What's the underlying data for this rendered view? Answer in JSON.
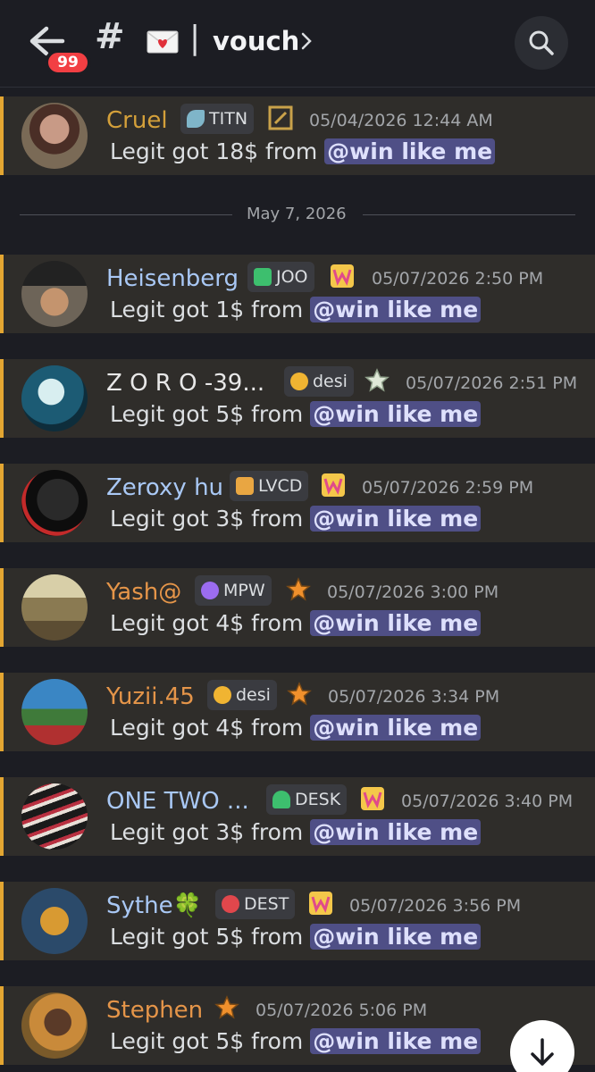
{
  "header": {
    "notification_count": "99",
    "hash": "#",
    "separator": "|",
    "channel_name": "vouch"
  },
  "date_divider": "May 7, 2026",
  "messages": [
    {
      "name": "Cruel",
      "name_color": "#d4a03a",
      "tag": "TITN",
      "tag_icon_color": "#7fb5c9",
      "timestamp": "05/04/2026 12:44 AM",
      "text": "Legit got 18$ from",
      "mention": "@win like me"
    },
    {
      "name": "Heisenberg",
      "name_color": "#a9c8f5",
      "tag": "JOO",
      "tag_icon_color": "#3dbf6e",
      "timestamp": "05/07/2026 2:50 PM",
      "text": "Legit got 1$ from",
      "mention": "@win like me"
    },
    {
      "name": "Z O R O -39...",
      "name_color": "#e8e8e8",
      "tag": "desi",
      "tag_icon_color": "#f0b432",
      "timestamp": "05/07/2026 2:51 PM",
      "text": "Legit got 5$ from",
      "mention": "@win like me"
    },
    {
      "name": "Zeroxy hu",
      "name_color": "#a9c8f5",
      "tag": "LVCD",
      "tag_icon_color": "#e9a642",
      "timestamp": "05/07/2026 2:59 PM",
      "text": "Legit got 3$ from",
      "mention": "@win like me"
    },
    {
      "name": "Yash@",
      "name_color": "#e59549",
      "tag": "MPW",
      "tag_icon_color": "#9b6cf0",
      "timestamp": "05/07/2026 3:00 PM",
      "text": "Legit got 4$ from",
      "mention": "@win like me"
    },
    {
      "name": "Yuzii.45",
      "name_color": "#e59549",
      "tag": "desi",
      "tag_icon_color": "#f0b432",
      "timestamp": "05/07/2026 3:34 PM",
      "text": "Legit got 4$ from",
      "mention": "@win like me"
    },
    {
      "name": "ONE TWO ...",
      "name_color": "#a9c8f5",
      "tag": "DESK",
      "tag_icon_color": "#3dbf6e",
      "timestamp": "05/07/2026 3:40 PM",
      "text": "Legit got 3$ from",
      "mention": "@win like me"
    },
    {
      "name": "Sythe🍀",
      "name_color": "#a9c8f5",
      "tag": "DEST",
      "tag_icon_color": "#e0474c",
      "timestamp": "05/07/2026 3:56 PM",
      "text": "Legit got 5$ from",
      "mention": "@win like me"
    },
    {
      "name": "Stephen",
      "name_color": "#e59549",
      "tag": "",
      "tag_icon_color": "",
      "timestamp": "05/07/2026 5:06 PM",
      "text": "Legit got 5$ from",
      "mention": "@win like me"
    }
  ]
}
